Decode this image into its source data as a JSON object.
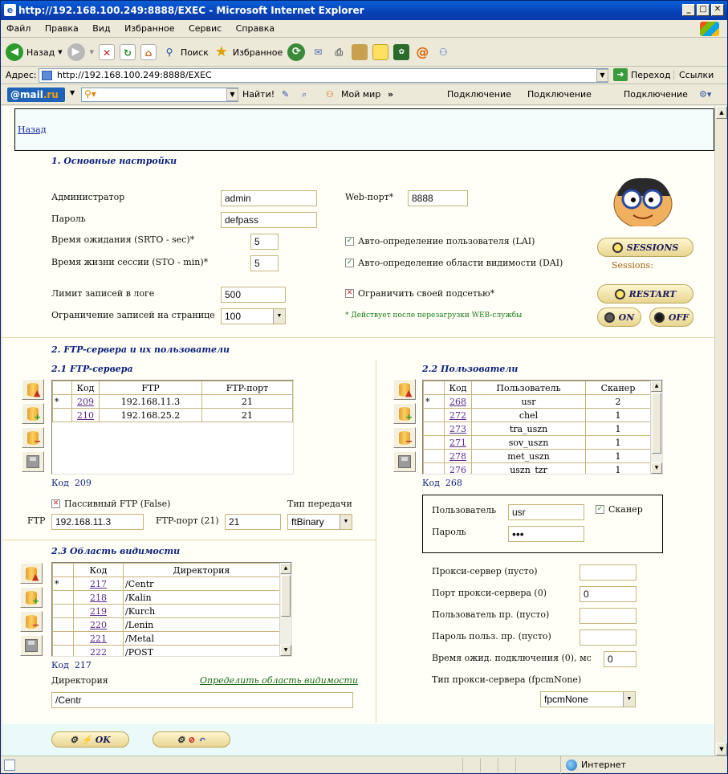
{
  "window": {
    "title": "http://192.168.100.249:8888/EXEC - Microsoft Internet Explorer"
  },
  "menu": [
    "Файл",
    "Правка",
    "Вид",
    "Избранное",
    "Сервис",
    "Справка"
  ],
  "toolbar": {
    "back": "Назад",
    "search": "Поиск",
    "favorites": "Избранное"
  },
  "address": {
    "label": "Адрес:",
    "url": "http://192.168.100.249:8888/EXEC",
    "go": "Переход",
    "links": "Ссылки"
  },
  "mailbar": {
    "brand_a": "@mail",
    "brand_b": ".ru",
    "find": "Найти!",
    "moi_mir": "Мой мир",
    "conn1": "Подключение",
    "conn2": "Подключение",
    "conn3": "Подключение"
  },
  "status": {
    "zone": "Интернет"
  },
  "page": {
    "back_link": "Назад",
    "s1": {
      "title": "1. Основные настройки",
      "admin_label": "Администратор",
      "admin_value": "admin",
      "pass_label": "Пароль",
      "pass_value": "defpass",
      "srto_label": "Время ожидания (SRTO - sec)*",
      "srto_value": "5",
      "sto_label": "Время жизни сессии (STO - min)*",
      "sto_value": "5",
      "log_label": "Лимит записей в логе",
      "log_value": "500",
      "perpage_label": "Ограничение записей на странице",
      "perpage_value": "100",
      "webport_label": "Web-порт*",
      "webport_value": "8888",
      "lai_label": "Авто-определение пользователя (LAI)",
      "dai_label": "Авто-определение области видимости (DAI)",
      "subnet_label": "Ограничить своей подсетью*",
      "note": "* Действует после перезагрузки WEB-службы",
      "sessions_btn": "SESSIONS",
      "sessions_text": "Sessions:",
      "restart_btn": "RESTART",
      "on_btn": "ON",
      "off_btn": "OFF"
    },
    "s2": {
      "title": "2. FTP-сервера и их пользователи",
      "ftp_title": "2.1 FTP-сервера",
      "ftp_headers": [
        "",
        "Код",
        "FTP",
        "FTP-порт"
      ],
      "ftp_rows": [
        {
          "mark": "*",
          "code": "209",
          "ftp": "192.168.11.3",
          "port": "21"
        },
        {
          "mark": "",
          "code": "210",
          "ftp": "192.168.25.2",
          "port": "21"
        }
      ],
      "ftp_code_label": "Код",
      "ftp_code_value": "209",
      "passive_label": "Пассивный FTP (False)",
      "type_label": "Тип передачи",
      "ftp_label": "FTP",
      "ftp_value": "192.168.11.3",
      "ftpport_label": "FTP-порт (21)",
      "ftpport_value": "21",
      "type_value": "ftBinary",
      "users_title": "2.2 Пользователи",
      "users_headers": [
        "",
        "Код",
        "Пользователь",
        "Сканер"
      ],
      "users_rows": [
        {
          "mark": "*",
          "code": "268",
          "user": "usr",
          "scan": "2"
        },
        {
          "mark": "",
          "code": "272",
          "user": "chel",
          "scan": "1"
        },
        {
          "mark": "",
          "code": "273",
          "user": "tra_uszn",
          "scan": "1"
        },
        {
          "mark": "",
          "code": "271",
          "user": "sov_uszn",
          "scan": "1"
        },
        {
          "mark": "",
          "code": "278",
          "user": "met_uszn",
          "scan": "1"
        },
        {
          "mark": "",
          "code": "276",
          "user": "uszn_tzr",
          "scan": "1"
        }
      ],
      "users_code_label": "Код",
      "users_code_value": "268",
      "user_label": "Пользователь",
      "user_value": "usr",
      "scanner_label": "Сканер",
      "upass_label": "Пароль",
      "upass_value": "•••",
      "proxy_label": "Прокси-сервер (пусто)",
      "proxy_value": "",
      "proxyport_label": "Порт прокси-сервера (0)",
      "proxyport_value": "0",
      "puser_label": "Пользователь пр. (пусто)",
      "puser_value": "",
      "ppass_label": "Пароль польз. пр. (пусто)",
      "ppass_value": "",
      "timeout_label": "Время ожид. подключения (0), мс",
      "timeout_value": "0",
      "ptype_label": "Тип прокси-сервера (fpcmNone)",
      "ptype_value": "fpcmNone"
    },
    "s3": {
      "title": "2.3 Область видимости",
      "headers": [
        "",
        "Код",
        "Директория"
      ],
      "rows": [
        {
          "mark": "*",
          "code": "217",
          "dir": "/Centr"
        },
        {
          "mark": "",
          "code": "218",
          "dir": "/Kalin"
        },
        {
          "mark": "",
          "code": "219",
          "dir": "/Kurch"
        },
        {
          "mark": "",
          "code": "220",
          "dir": "/Lenin"
        },
        {
          "mark": "",
          "code": "221",
          "dir": "/Metal"
        },
        {
          "mark": "",
          "code": "222",
          "dir": "/POST"
        }
      ],
      "code_label": "Код",
      "code_value": "217",
      "dir_label": "Директория",
      "dir_link": "Определить область видимости",
      "dir_value": "/Centr"
    },
    "ok_btn": "OK"
  }
}
